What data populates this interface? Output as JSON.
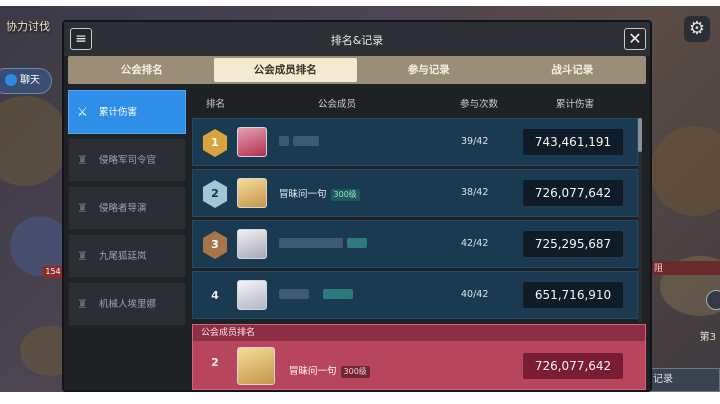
{
  "scene": {
    "top_left_title": "协力讨伐",
    "chat_label": "聊天",
    "side_badge": "154",
    "right_text_1": "阻",
    "right_text_2": "第3",
    "right_button": "记录",
    "gear_icon": "gear-icon"
  },
  "panel": {
    "title": "排名&记录",
    "menu_icon": "menu-icon",
    "close_icon": "close-icon"
  },
  "tabs": [
    {
      "label": "公会排名",
      "active": false
    },
    {
      "label": "公会成员排名",
      "active": true
    },
    {
      "label": "参与记录",
      "active": false
    },
    {
      "label": "战斗记录",
      "active": false
    }
  ],
  "sidebar": [
    {
      "label": "累计伤害",
      "active": true
    },
    {
      "label": "侵略军司令官",
      "active": false
    },
    {
      "label": "侵略者导演",
      "active": false
    },
    {
      "label": "九尾狐廷岚",
      "active": false
    },
    {
      "label": "机械人埃里娜",
      "active": false
    }
  ],
  "columns": {
    "rank": "排名",
    "member": "公会成员",
    "participation": "参与次数",
    "damage": "累计伤害"
  },
  "rows": [
    {
      "rank": "1",
      "name": "",
      "level": "",
      "count": "39/42",
      "damage": "743,461,191"
    },
    {
      "rank": "2",
      "name": "冒昧问一句",
      "level": "300级",
      "count": "38/42",
      "damage": "726,077,642"
    },
    {
      "rank": "3",
      "name": "",
      "level": "",
      "count": "42/42",
      "damage": "725,295,687"
    },
    {
      "rank": "4",
      "name": "",
      "level": "",
      "count": "40/42",
      "damage": "651,716,910"
    }
  ],
  "my_rank": {
    "header": "公会成员排名",
    "rank": "2",
    "name": "冒昧问一句",
    "level": "300级",
    "damage": "726,077,642"
  }
}
